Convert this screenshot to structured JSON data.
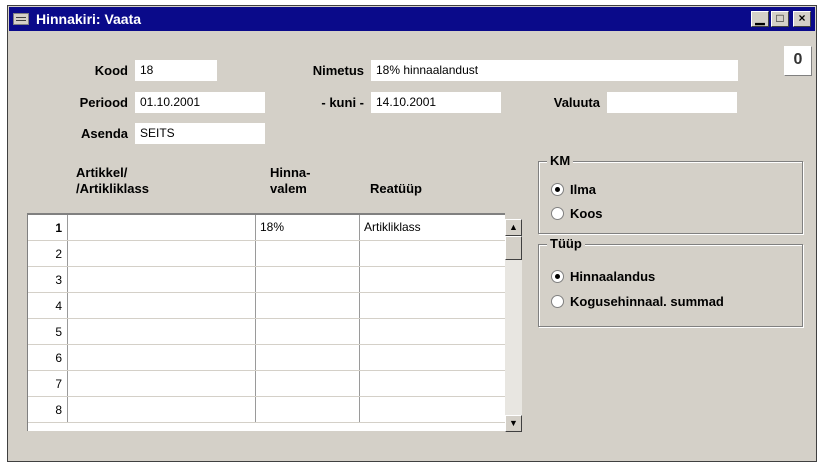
{
  "window": {
    "title": "Hinnakiri: Vaata",
    "minimize_glyph": "▁",
    "maximize_glyph": "□",
    "close_glyph": "×",
    "attach_glyph": "0"
  },
  "fields": {
    "kood_label": "Kood",
    "kood_value": "18",
    "nimetus_label": "Nimetus",
    "nimetus_value": "18% hinnaalandust",
    "periood_label": "Periood",
    "periood_value": "01.10.2001",
    "kuni_label": "- kuni -",
    "kuni_value": "14.10.2001",
    "valuuta_label": "Valuuta",
    "valuuta_value": "",
    "asenda_label": "Asenda",
    "asenda_value": "SEITS"
  },
  "grid": {
    "headers": [
      "Artikkel/\n/Artikliklass",
      "Hinna-\nvalem",
      "Reatüüp"
    ],
    "rows": [
      {
        "n": "1",
        "artikkel": "",
        "valem": "18%",
        "reatyyp": "Artikliklass"
      },
      {
        "n": "2",
        "artikkel": "",
        "valem": "",
        "reatyyp": ""
      },
      {
        "n": "3",
        "artikkel": "",
        "valem": "",
        "reatyyp": ""
      },
      {
        "n": "4",
        "artikkel": "",
        "valem": "",
        "reatyyp": ""
      },
      {
        "n": "5",
        "artikkel": "",
        "valem": "",
        "reatyyp": ""
      },
      {
        "n": "6",
        "artikkel": "",
        "valem": "",
        "reatyyp": ""
      },
      {
        "n": "7",
        "artikkel": "",
        "valem": "",
        "reatyyp": ""
      },
      {
        "n": "8",
        "artikkel": "",
        "valem": "",
        "reatyyp": ""
      }
    ]
  },
  "km": {
    "title": "KM",
    "options": [
      {
        "label": "Ilma",
        "selected": true
      },
      {
        "label": "Koos",
        "selected": false
      }
    ]
  },
  "tyyp": {
    "title": "Tüüp",
    "options": [
      {
        "label": "Hinnaalandus",
        "selected": true
      },
      {
        "label": "Kogusehinnaal. summad",
        "selected": false
      }
    ]
  }
}
